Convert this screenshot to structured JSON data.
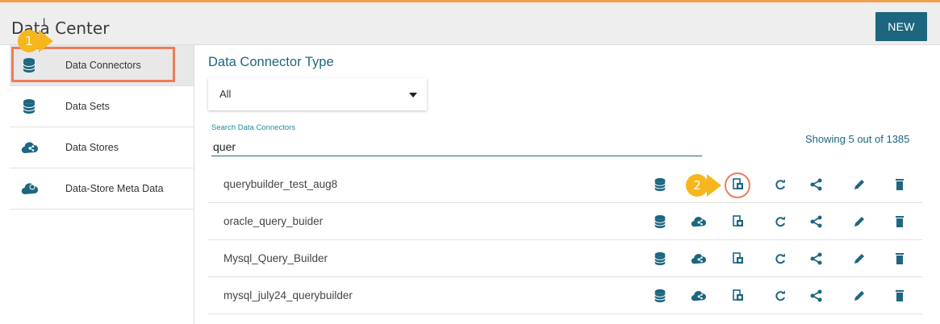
{
  "header": {
    "title": "Data Center",
    "cursor_glyph": "I",
    "new_label": "NEW"
  },
  "sidebar": {
    "items": [
      {
        "label": "Data Connectors",
        "icon": "database-icon",
        "active": true
      },
      {
        "label": "Data Sets",
        "icon": "database-icon"
      },
      {
        "label": "Data Stores",
        "icon": "cloud-share-icon"
      },
      {
        "label": "Data-Store Meta Data",
        "icon": "cloud-icon"
      }
    ]
  },
  "callouts": {
    "one": "1",
    "two": "2"
  },
  "main": {
    "title": "Data Connector Type",
    "type_select": {
      "value": "All"
    },
    "search": {
      "label": "Search Data Connectors",
      "value": "quer"
    },
    "showing": "Showing 5 out of 1385",
    "rows": [
      {
        "name": "querybuilder_test_aug8",
        "actions": [
          "database-icon",
          "query-builder-icon",
          "refresh-icon",
          "share-icon",
          "edit-icon",
          "delete-icon"
        ]
      },
      {
        "name": "oracle_query_buider",
        "actions": [
          "database-icon",
          "cloud-share-icon",
          "query-builder-icon",
          "refresh-icon",
          "share-icon",
          "edit-icon",
          "delete-icon"
        ]
      },
      {
        "name": "Mysql_Query_Builder",
        "actions": [
          "database-icon",
          "cloud-share-icon",
          "query-builder-icon",
          "refresh-icon",
          "share-icon",
          "edit-icon",
          "delete-icon"
        ]
      },
      {
        "name": "mysql_july24_querybuilder",
        "actions": [
          "database-icon",
          "cloud-share-icon",
          "query-builder-icon",
          "refresh-icon",
          "share-icon",
          "edit-icon",
          "delete-icon"
        ]
      }
    ]
  },
  "colors": {
    "accent": "#1d6680",
    "highlight": "#ec7c5b",
    "callout": "#f5b71d"
  }
}
